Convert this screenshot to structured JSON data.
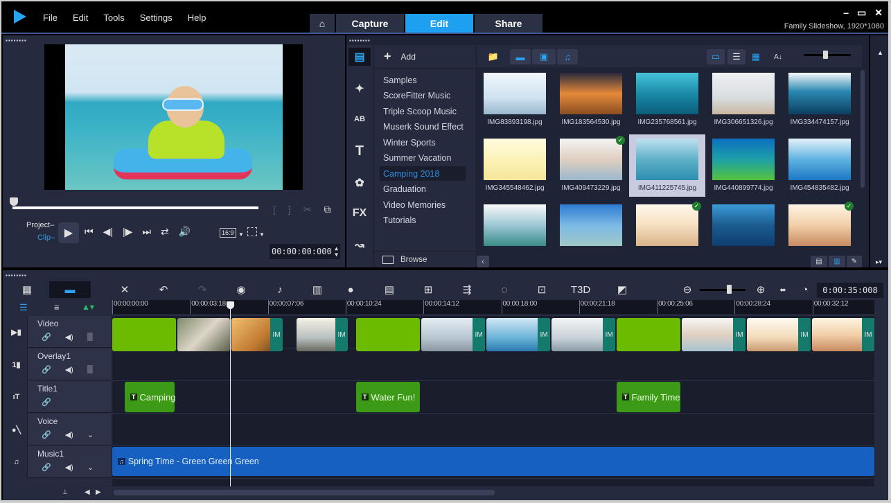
{
  "menu": {
    "items": [
      "File",
      "Edit",
      "Tools",
      "Settings",
      "Help"
    ]
  },
  "nav_tabs": {
    "home_icon": "home-icon",
    "capture": "Capture",
    "edit": "Edit",
    "share": "Share",
    "active": "Edit"
  },
  "window": {
    "project_info": "Family Slideshow, 1920*1080",
    "minimize": "–",
    "restore": "▭",
    "close": "✕"
  },
  "player": {
    "mode_project": "Project",
    "mode_clip": "Clip",
    "aspect": "16:9",
    "timecode": "00:00:00:000",
    "controls": [
      "play",
      "home",
      "prev-frame",
      "next-frame",
      "end",
      "repeat",
      "volume"
    ]
  },
  "library": {
    "add_label": "Add",
    "browse_label": "Browse",
    "folders": [
      "Samples",
      "ScoreFitter Music",
      "Triple Scoop Music",
      "Muserk Sound Effect",
      "Winter Sports",
      "Summer Vacation",
      "Camping 2018",
      "Graduation",
      "Video Memories",
      "Tutorials"
    ],
    "active_folder": "Camping 2018",
    "thumbnails": [
      {
        "name": "IMG83893198.jpg",
        "checked": false,
        "selected": false
      },
      {
        "name": "IMG183564530.jpg",
        "checked": false,
        "selected": false
      },
      {
        "name": "IMG235768561.jpg",
        "checked": false,
        "selected": false
      },
      {
        "name": "IMG306651326.jpg",
        "checked": false,
        "selected": false
      },
      {
        "name": "IMG334474157.jpg",
        "checked": false,
        "selected": false
      },
      {
        "name": "IMG345548462.jpg",
        "checked": false,
        "selected": false
      },
      {
        "name": "IMG409473229.jpg",
        "checked": true,
        "selected": false
      },
      {
        "name": "IMG411225745.jpg",
        "checked": false,
        "selected": true
      },
      {
        "name": "IMG440899774.jpg",
        "checked": false,
        "selected": false
      },
      {
        "name": "IMG454835482.jpg",
        "checked": false,
        "selected": false
      },
      {
        "name": "",
        "checked": false,
        "selected": false
      },
      {
        "name": "",
        "checked": false,
        "selected": false
      },
      {
        "name": "",
        "checked": true,
        "selected": false
      },
      {
        "name": "",
        "checked": false,
        "selected": false
      },
      {
        "name": "",
        "checked": true,
        "selected": false
      }
    ],
    "sort_icon": "A-Z sort"
  },
  "timeline": {
    "total_timecode": "0:00:35:008",
    "ruler_ticks": [
      "00:00:00:00",
      "00:00:03:18",
      "00:00:07:06",
      "00:00:10:24",
      "00:00:14:12",
      "00:00:18:00",
      "00:00:21:18",
      "00:00:25:06",
      "00:00:28:24",
      "00:00:32:12"
    ],
    "tracks": [
      {
        "name": "Video",
        "icon": "V"
      },
      {
        "name": "Overlay1",
        "icon": "1"
      },
      {
        "name": "Title1",
        "icon": "T"
      },
      {
        "name": "Voice",
        "icon": "mic"
      },
      {
        "name": "Music1",
        "icon": "music"
      }
    ],
    "clip_tag": "IM",
    "titles": [
      "Camping",
      "Water Fun!",
      "Family Time"
    ],
    "music_clip": "Spring Time - Green Green Green"
  },
  "colors": {
    "accent": "#1ea0f0",
    "title_clip": "#3d9a16",
    "color_clip": "#6dbb00",
    "music_clip": "#1560c0",
    "photo_tag": "#147a6c"
  }
}
